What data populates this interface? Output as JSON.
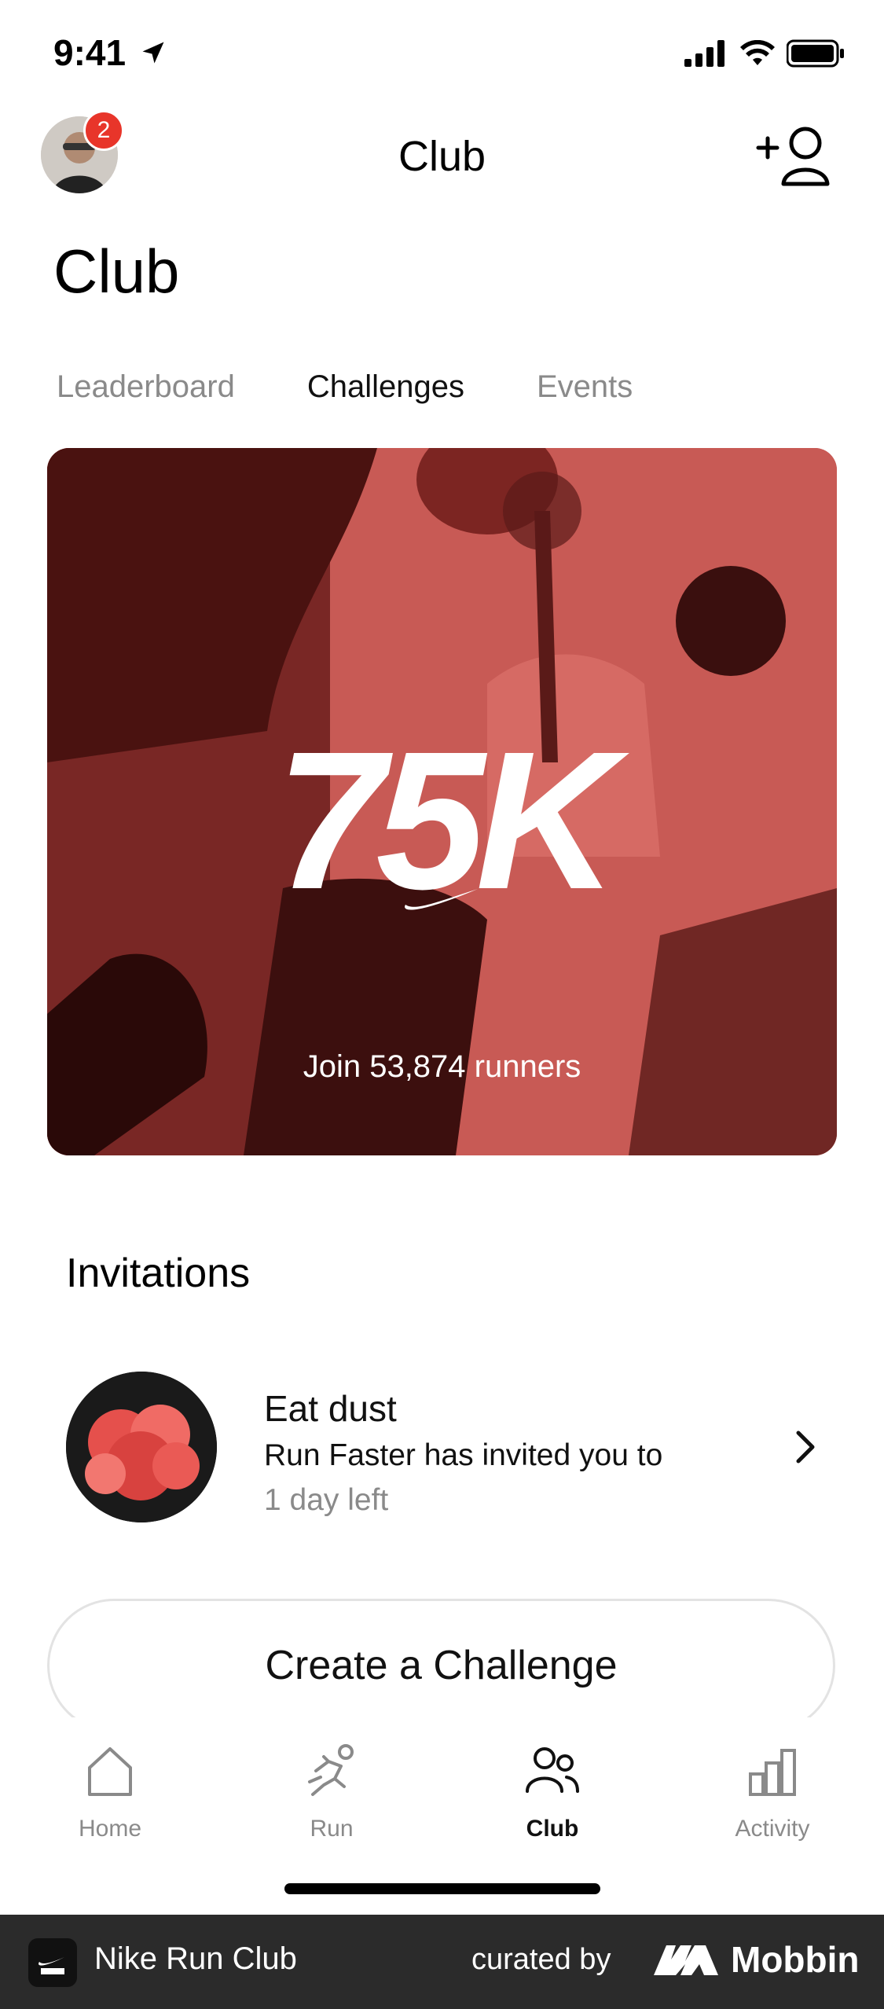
{
  "status_bar": {
    "time": "9:41"
  },
  "nav": {
    "title": "Club",
    "badge_count": "2"
  },
  "page_title": "Club",
  "tabs": [
    {
      "label": "Leaderboard",
      "active": false
    },
    {
      "label": "Challenges",
      "active": true
    },
    {
      "label": "Events",
      "active": false
    }
  ],
  "hero": {
    "headline": "75K",
    "subtitle": "Join 53,874 runners",
    "tint_color": "#c7534f"
  },
  "invitations": {
    "title": "Invitations",
    "item": {
      "title": "Eat dust",
      "description": "Run Faster has invited you to",
      "time_left": "1 day left"
    }
  },
  "create_button": "Create a Challenge",
  "tab_bar": [
    {
      "label": "Home",
      "icon": "home-icon",
      "active": false
    },
    {
      "label": "Run",
      "icon": "run-icon",
      "active": false
    },
    {
      "label": "Club",
      "icon": "club-icon",
      "active": true
    },
    {
      "label": "Activity",
      "icon": "activity-icon",
      "active": false
    }
  ],
  "banner": {
    "app_name": "Nike Run Club",
    "curated_by": "curated by",
    "brand": "Mobbin"
  }
}
